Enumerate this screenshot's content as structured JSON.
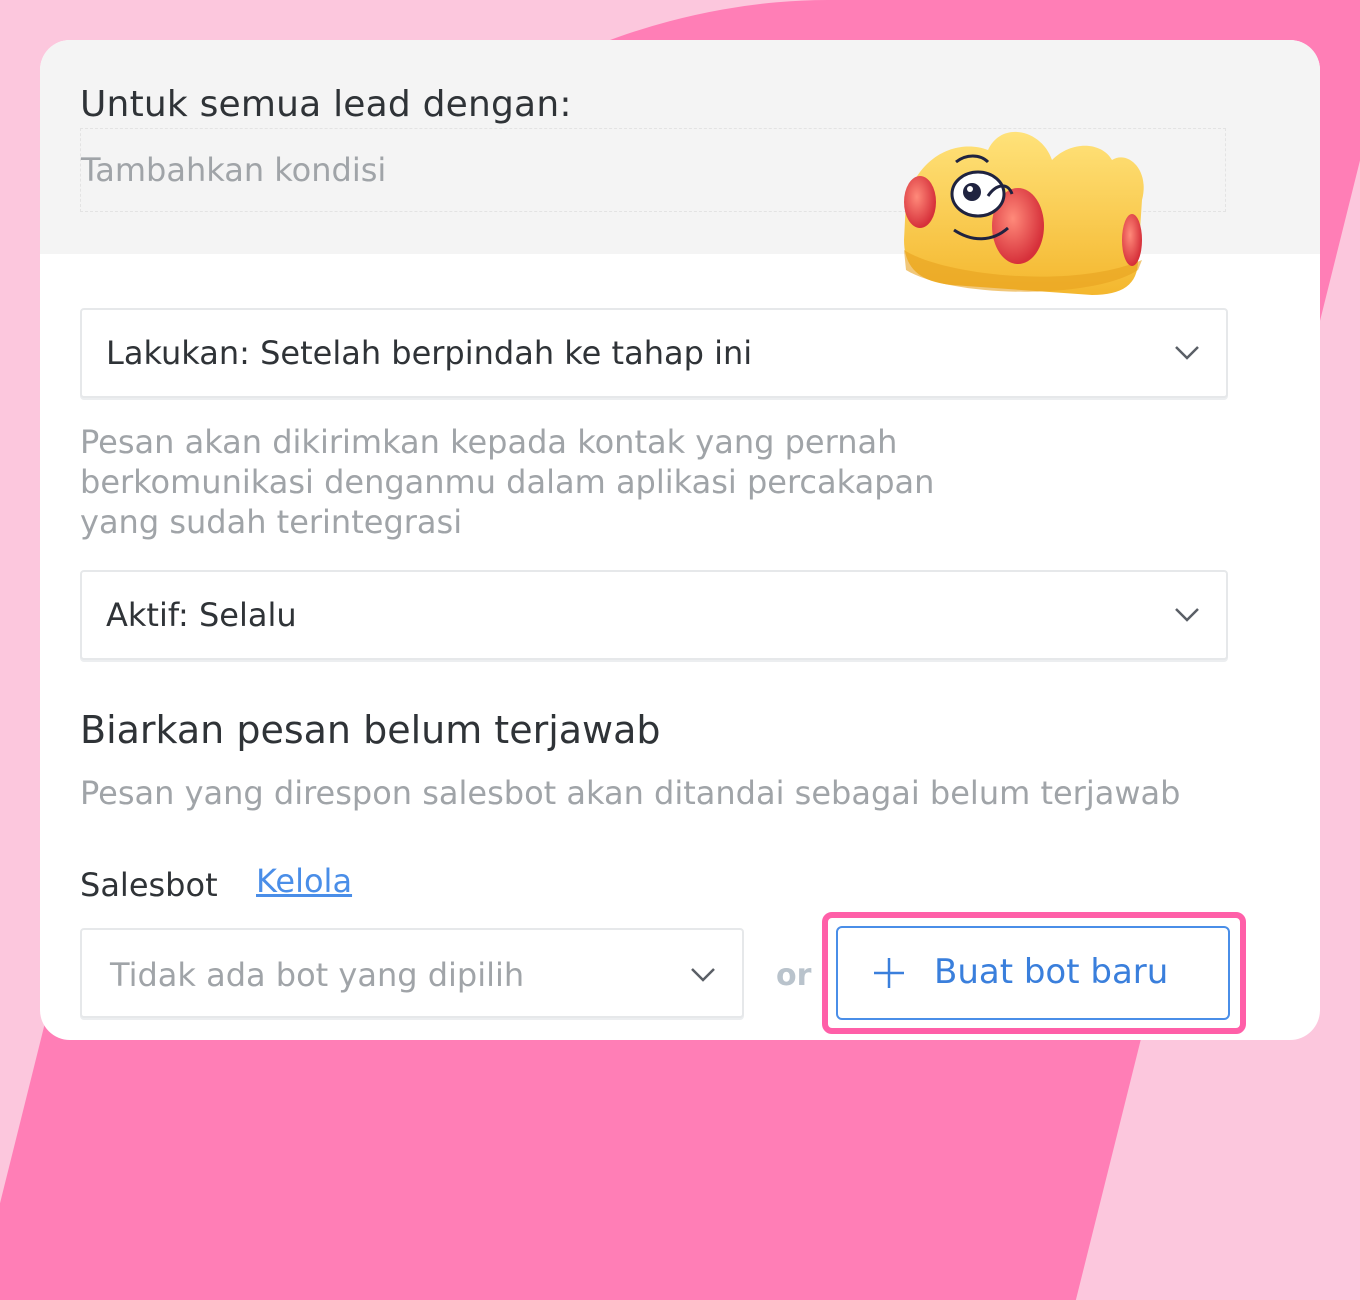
{
  "condition": {
    "heading": "Untuk semua lead dengan:",
    "add_condition_placeholder": "Tambahkan kondisi"
  },
  "action_select": {
    "label": "Lakukan: Setelah berpindah ke tahap ini",
    "icon": "chevron-down-icon"
  },
  "description": "Pesan akan dikirimkan kepada kontak yang pernah berkomunikasi denganmu dalam aplikasi percakapan yang sudah terintegrasi",
  "active_select": {
    "label": "Aktif: Selalu",
    "icon": "chevron-down-icon"
  },
  "unanswered": {
    "title": "Biarkan pesan belum terjawab",
    "description": "Pesan yang direspon salesbot akan ditandai sebagai belum terjawab"
  },
  "salesbot": {
    "label": "Salesbot",
    "manage_link": "Kelola",
    "select_placeholder": "Tidak ada bot yang dipilih",
    "or_text": "or",
    "new_bot_label": "Buat bot baru",
    "new_bot_icon": "plus-icon"
  },
  "colors": {
    "background": "#fcc7dd",
    "accent_pink": "#ff7eb6",
    "highlight": "#ff5fa8",
    "link_blue": "#4a8ee8"
  }
}
